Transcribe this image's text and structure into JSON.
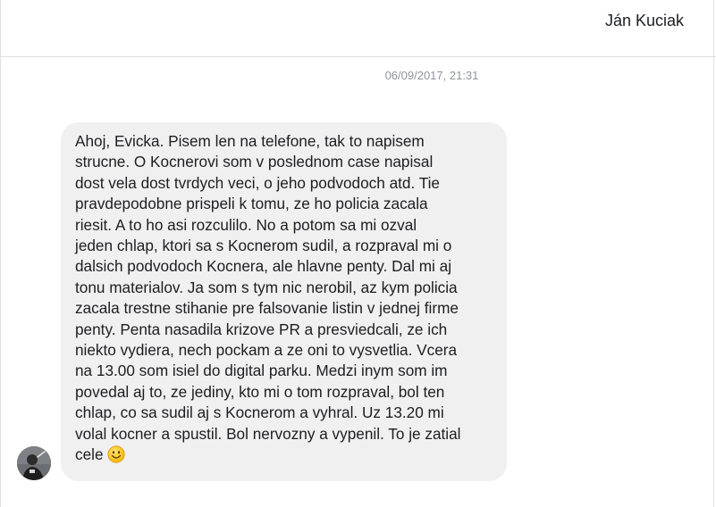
{
  "header": {
    "contact_name": "Ján Kuciak"
  },
  "conversation": {
    "timestamp": "06/09/2017, 21:31",
    "message": {
      "lines": [
        "Ahoj, Evicka. Pisem len na telefone, tak to napisem",
        "strucne. O Kocnerovi som v poslednom case napisal",
        "dost vela dost tvrdych veci, o jeho podvodoch atd. Tie",
        "pravdepodobne prispeli k tomu, ze ho policia zacala",
        "riesit. A to ho asi rozculilo. No a potom sa mi ozval",
        "jeden chlap, ktori sa s Kocnerom sudil, a rozpraval mi o",
        "dalsich podvodoch Kocnera, ale hlavne penty. Dal mi aj",
        "tonu materialov. Ja som s tym nic nerobil, az kym policia",
        "zacala trestne stihanie pre falsovanie listin v jednej firme",
        "penty. Penta nasadila krizove PR a presviedcali, ze ich",
        "niekto vydiera, nech pockam a ze oni to vysvetlia. Vcera",
        "na 13.00 som isiel do digital parku. Medzi inym som im",
        "povedal aj to, ze jediny, kto mi o tom rozpraval, bol ten",
        "chlap, co sa sudil aj s Kocnerom a vyhral. Uz 13.20 mi",
        "volal kocner a spustil. Bol nervozny a vypenil. To je zatial",
        "cele"
      ],
      "emoji": "smiling-face-icon"
    }
  },
  "colors": {
    "bubble_bg": "#f1f0f0",
    "timestamp": "#90949c",
    "divider": "#dddfe2"
  }
}
